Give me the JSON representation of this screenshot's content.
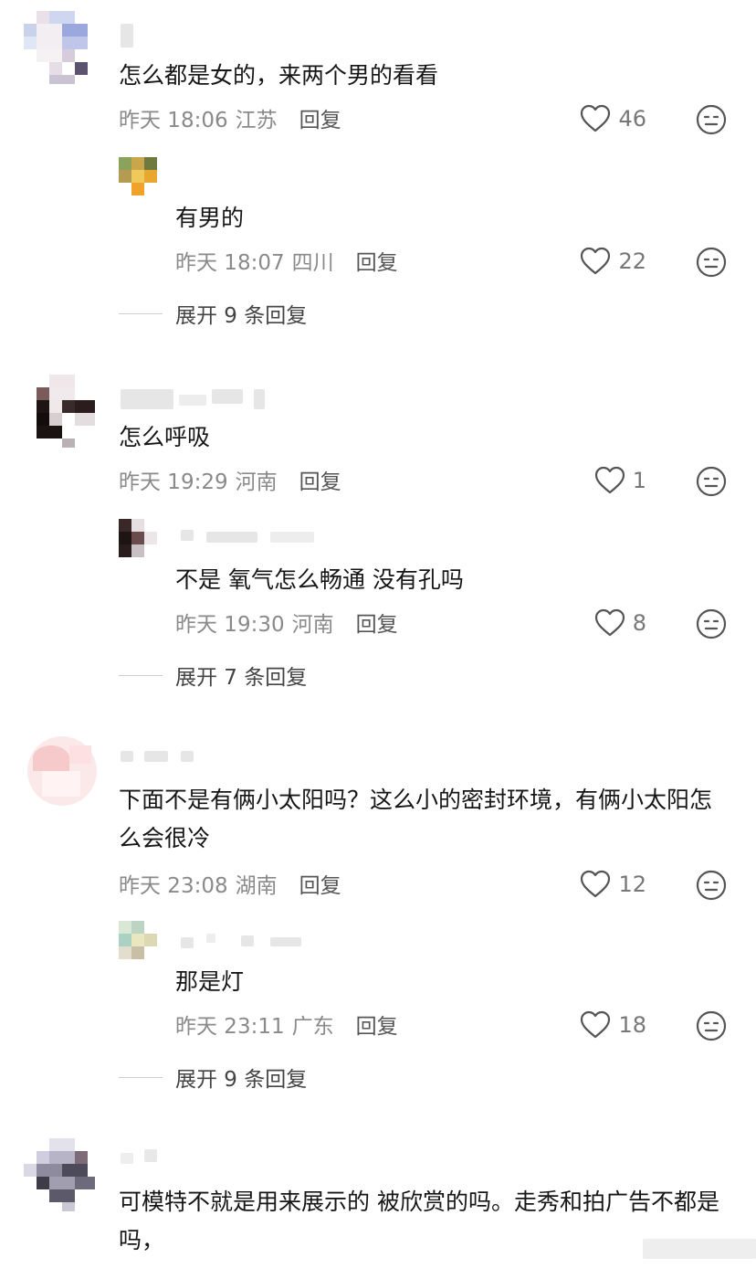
{
  "comments": [
    {
      "text": "怎么都是女的，来两个男的看看",
      "time": "昨天 18:06",
      "region": "江苏",
      "reply_label": "回复",
      "likes": "46",
      "reply": {
        "text": "有男的",
        "time": "昨天 18:07",
        "region": "四川",
        "reply_label": "回复",
        "likes": "22"
      },
      "expand_label": "展开 9 条回复"
    },
    {
      "text": "怎么呼吸",
      "time": "昨天 19:29",
      "region": "河南",
      "reply_label": "回复",
      "likes": "1",
      "reply": {
        "text": "不是 氧气怎么畅通 没有孔吗",
        "time": "昨天 19:30",
        "region": "河南",
        "reply_label": "回复",
        "likes": "8"
      },
      "expand_label": "展开 7 条回复"
    },
    {
      "text": "下面不是有俩小太阳吗？这么小的密封环境，有俩小太阳怎么会很冷",
      "time": "昨天 23:08",
      "region": "湖南",
      "reply_label": "回复",
      "likes": "12",
      "reply": {
        "text": "那是灯",
        "time": "昨天 23:11",
        "region": "广东",
        "reply_label": "回复",
        "likes": "18"
      },
      "expand_label": "展开 9 条回复"
    },
    {
      "text": "可模特不就是用来展示的 被欣赏的吗。走秀和拍广告不都是吗，"
    }
  ],
  "icons": {
    "like": "heart-outline-icon",
    "emoji": "neutral-face-icon"
  },
  "colors": {
    "meta_text": "#8a8a8a",
    "body_text": "#161616",
    "icon_stroke": "#555555"
  }
}
